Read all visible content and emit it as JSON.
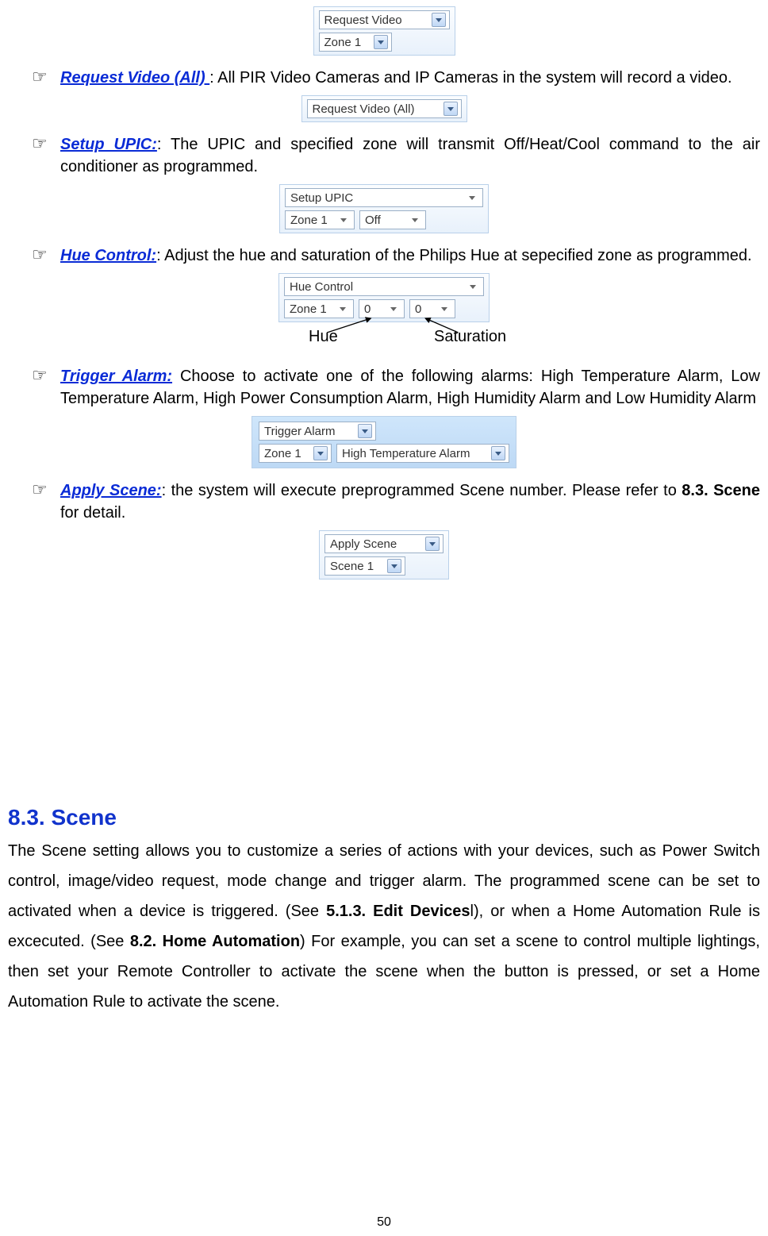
{
  "figures": {
    "top": {
      "row1": "Request Video",
      "row2": "Zone 1"
    },
    "reqAll": {
      "row1": "Request Video (All)"
    },
    "upic": {
      "row1": "Setup UPIC",
      "zone": "Zone 1",
      "mode": "Off"
    },
    "hue": {
      "row1": "Hue Control",
      "zone": "Zone 1",
      "v1": "0",
      "v2": "0"
    },
    "trigger": {
      "row1": "Trigger Alarm",
      "zone": "Zone 1",
      "alarm": "High Temperature Alarm"
    },
    "scene": {
      "row1": "Apply Scene",
      "val": "Scene 1"
    }
  },
  "hueAnno": {
    "hue": "Hue",
    "sat": "Saturation"
  },
  "items": {
    "reqAll": {
      "title": "Request Video (All) ",
      "rest": ": All PIR Video Cameras  and IP Cameras in the system will record a video."
    },
    "upic": {
      "title": "Setup UPIC:",
      "rest": ": The UPIC and specified zone will transmit Off/Heat/Cool command to the air conditioner as programmed."
    },
    "hue": {
      "title": "Hue Control:",
      "rest": ": Adjust the hue and saturation of the Philips Hue at sepecified zone as programmed."
    },
    "trigger": {
      "title": "Trigger Alarm:",
      "rest": " Choose to activate one of the following alarms: High Temperature Alarm, Low Temperature Alarm, High Power Consumption Alarm, High Humidity Alarm and Low Humidity Alarm"
    },
    "apply": {
      "title": "Apply Scene:",
      "rest_a": ": the system will execute preprogrammed Scene number. Please refer to ",
      "rest_bold": "8.3. Scene",
      "rest_b": " for detail."
    }
  },
  "sceneSection": {
    "heading": "8.3. Scene",
    "p1a": "The Scene setting allows you to customize a series of actions with your devices, such as Power Switch control, image/video request, mode change and trigger alarm. The programmed scene can be set to activated when a device is triggered. (See ",
    "p1b": "5.1.3. Edit Devices",
    "p1c": "l), or when a Home Automation Rule is excecuted. (See ",
    "p1d": "8.2. Home Automation",
    "p1e": ") For example, you can set a scene to control multiple lightings, then set your Remote Controller to activate the scene when the button is pressed, or set a Home Automation Rule to activate the scene."
  },
  "pageNumber": "50",
  "bullet": "☞"
}
